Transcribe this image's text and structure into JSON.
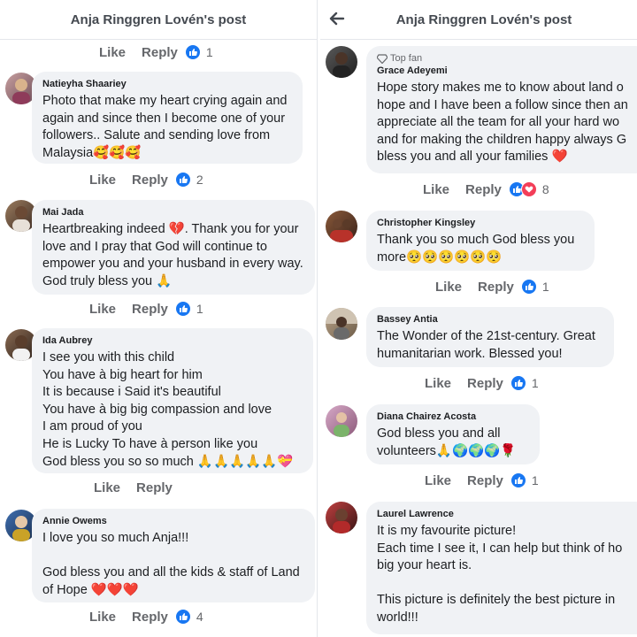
{
  "left": {
    "header_title": "Anja Ringgren Lovén's post",
    "top_actions": {
      "like": "Like",
      "reply": "Reply",
      "count": "1"
    },
    "comments": [
      {
        "author": "Natieyha Shaariey",
        "lines": [
          "Photo that make my heart crying again and",
          "again and since then I become one of your",
          "followers.. Salute and sending love from",
          "Malaysia🥰🥰🥰"
        ],
        "like": "Like",
        "reply": "Reply",
        "count": "2"
      },
      {
        "author": "Mai Jada",
        "lines": [
          "Heartbreaking indeed 💔. Thank you for your",
          "love and I pray that God will continue to",
          "empower you and your husband in every way.",
          "God truly bless you 🙏"
        ],
        "like": "Like",
        "reply": "Reply",
        "count": "1"
      },
      {
        "author": "Ida Aubrey",
        "lines": [
          "I see you with this child",
          "You have à big heart for him",
          "It is because i Said it's beautiful",
          "You have à big big compassion and love",
          "I am proud of you",
          "He is Lucky To have à person like you",
          "God bless you so so much 🙏🙏🙏🙏🙏💝"
        ],
        "like": "Like",
        "reply": "Reply"
      },
      {
        "author": "Annie Owems",
        "lines": [
          "I love you so much Anja!!!",
          "",
          "God bless you and all the kids & staff of Land",
          "of Hope ❤️❤️❤️"
        ],
        "like": "Like",
        "reply": "Reply",
        "count": "4"
      }
    ]
  },
  "right": {
    "header_title": "Anja Ringgren Lovén's post",
    "comments": [
      {
        "badge": "Top fan",
        "author": "Grace Adeyemi",
        "lines": [
          "Hope story makes me to know about land o",
          "hope and I have been a follow since then an",
          "appreciate all the team for all your hard wo",
          "and for making the children happy always G",
          "bless you and all your families ❤️"
        ],
        "like": "Like",
        "reply": "Reply",
        "count": "8"
      },
      {
        "author": "Christopher Kingsley",
        "lines": [
          "Thank you so much God bless you",
          "more🥺🥺🥺🥺🥺🥺"
        ],
        "like": "Like",
        "reply": "Reply",
        "count": "1"
      },
      {
        "author": "Bassey Antia",
        "lines": [
          "The Wonder of the 21st-century. Great",
          "humanitarian work. Blessed you!"
        ],
        "like": "Like",
        "reply": "Reply",
        "count": "1"
      },
      {
        "author": "Diana Chairez Acosta",
        "lines": [
          "God bless you and all",
          "volunteers🙏🌍🌍🌍🌹"
        ],
        "like": "Like",
        "reply": "Reply",
        "count": "1"
      },
      {
        "author": "Laurel Lawrence",
        "lines": [
          "It is my favourite picture!",
          "Each time I see it, I can help but think of ho",
          "big your heart is.",
          "",
          "This picture is definitely the best picture in",
          "world!!!"
        ]
      }
    ]
  },
  "colors": {
    "like_blue": "#1877f2",
    "love_red": "#f33e58",
    "bubble": "#f0f2f5",
    "action_gray": "#65676b"
  }
}
